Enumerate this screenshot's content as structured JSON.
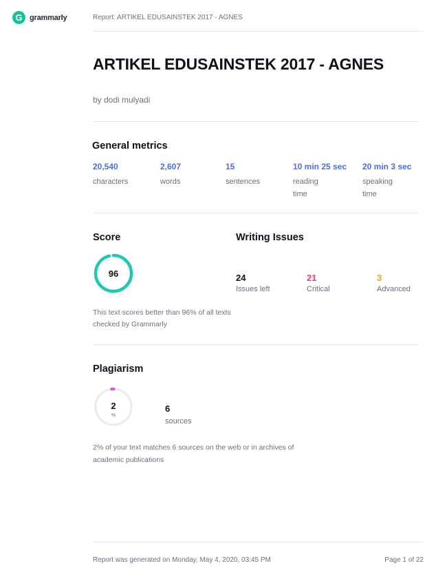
{
  "header": {
    "logo_text": "grammarly",
    "logo_letter": "G",
    "report_title": "Report: ARTIKEL EDUSAINSTEK 2017 - AGNES"
  },
  "document": {
    "title": "ARTIKEL EDUSAINSTEK 2017 - AGNES",
    "author": "by dodi mulyadi"
  },
  "general_metrics": {
    "heading": "General metrics",
    "items": [
      {
        "value": "20,540",
        "label": "characters"
      },
      {
        "value": "2,607",
        "label": "words"
      },
      {
        "value": "15",
        "label": "sentences"
      },
      {
        "value": "10 min 25 sec",
        "label": "reading time"
      },
      {
        "value": "20 min 3 sec",
        "label": "speaking time"
      }
    ]
  },
  "score": {
    "heading": "Score",
    "value": "96",
    "ring_fraction": 0.96,
    "description": "This text scores better than 96% of all texts checked by Grammarly"
  },
  "writing_issues": {
    "heading": "Writing Issues",
    "items": [
      {
        "value": "24",
        "label": "Issues left",
        "color": "#0e101a"
      },
      {
        "value": "21",
        "label": "Critical",
        "color": "#e8416b"
      },
      {
        "value": "3",
        "label": "Advanced",
        "color": "#f2a50c"
      }
    ]
  },
  "plagiarism": {
    "heading": "Plagiarism",
    "value": "2",
    "unit": "%",
    "ring_fraction": 0.02,
    "sources_count": "6",
    "sources_label": "sources",
    "description": "2% of your text matches 6 sources on the web or in archives of academic publications"
  },
  "footer": {
    "generated": "Report was generated on Monday, May 4, 2020, 03:45 PM",
    "page": "Page 1 of 22"
  },
  "colors": {
    "brand": "#15c39a",
    "metric_blue": "#4a6ee0",
    "score_ring": "#1fc8b6",
    "plag_ring": "#d45ad6",
    "ring_track": "#e9ebf2"
  }
}
